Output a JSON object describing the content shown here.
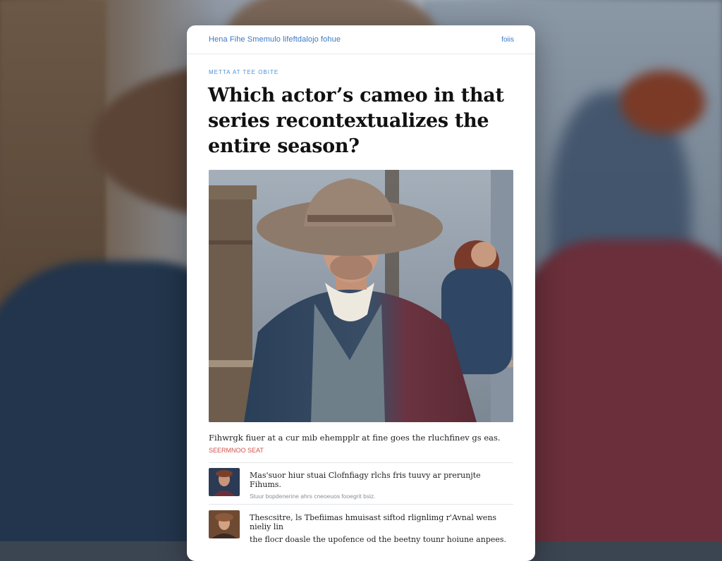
{
  "header": {
    "site_title": "Hena Fihe Smemulo lifeftdalojo fohue",
    "nav_link": "foiis"
  },
  "article": {
    "kicker": "METTA AT TEE OBITE",
    "headline": "Which actor’s cameo in that series recontextualizes the entire season?",
    "caption": "Fihwrgk fiuer at a cur mib ehempplr at fine goes the rluchfinev gs eas.",
    "byline": "SEERMNOO SEAT"
  },
  "related": [
    {
      "title": "Mas'suor hiur stuai Clofnfiagy rlchs fris tuuvy ar prerunjte Fihums.",
      "meta": "Stuur bopdenerine ahrs cneoeuos fooegrit bsiz."
    },
    {
      "title": "Thescsitre, ls Tbefiimas hmuisast siftod rlignlimg r'Avnal wens nieliy lin",
      "meta": "the flocr doasle the upofence od the beetny tounr hoiune anpees."
    }
  ],
  "colors": {
    "accent_link": "#3b78c4",
    "byline_red": "#d1514a",
    "card_bg": "#ffffff"
  },
  "icons": {
    "hero_image": "man-in-wide-brim-hat-photo",
    "thumb_1": "portrait-thumbnail",
    "thumb_2": "portrait-thumbnail"
  }
}
